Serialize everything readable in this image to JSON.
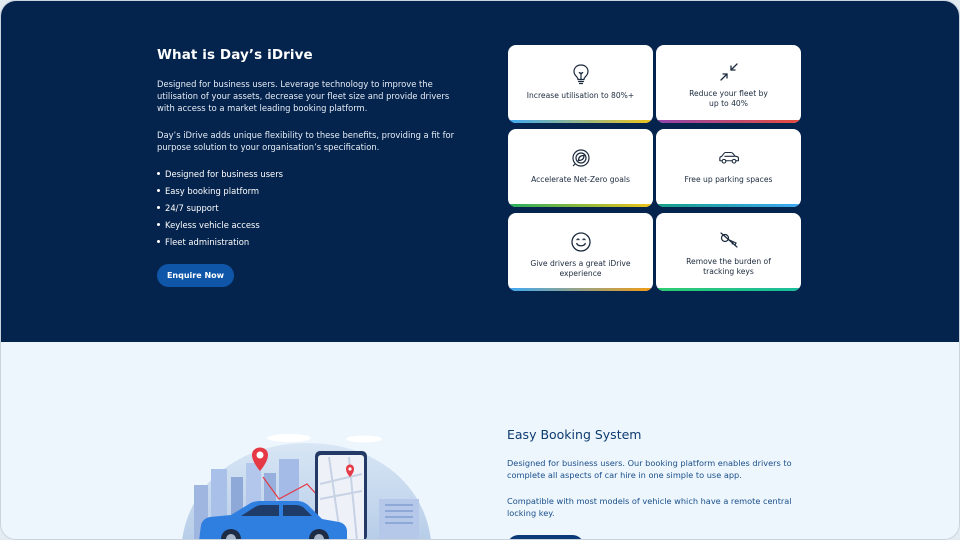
{
  "hero": {
    "title": "What is Day’s iDrive",
    "paragraph1": "Designed for business users. Leverage technology to improve the utilisation of your assets, decrease your fleet size and provide drivers with access to a market leading booking platform.",
    "paragraph2": "Day’s iDrive adds unique flexibility to these benefits, providing a fit for purpose solution to your organisation’s specification.",
    "bullets": [
      "Designed for business users",
      "Easy booking platform",
      "24/7 support",
      "Keyless vehicle access",
      "Fleet administration"
    ],
    "cta_label": "Enquire Now"
  },
  "cards": [
    {
      "label": "Increase utilisation to 80%+",
      "icon": "lightbulb-icon"
    },
    {
      "label": "Reduce your fleet by up to 40%",
      "icon": "shrink-arrows-icon"
    },
    {
      "label": "Accelerate Net-Zero goals",
      "icon": "target-leaf-icon"
    },
    {
      "label": "Free up parking spaces",
      "icon": "car-icon"
    },
    {
      "label": "Give drivers a great iDrive experience",
      "icon": "smiley-icon"
    },
    {
      "label": "Remove the burden of tracking keys",
      "icon": "no-key-icon"
    }
  ],
  "booking": {
    "title": "Easy Booking System",
    "paragraph1": "Designed for business users. Our booking platform enables drivers to complete all aspects of car hire in one simple to use app.",
    "paragraph2": "Compatible with most models of vehicle which have a remote central locking key."
  },
  "colors": {
    "hero_bg": "#05244d",
    "primary_button": "#0f56a8",
    "lower_bg": "#edf6fd",
    "heading_blue": "#0d3b70"
  }
}
